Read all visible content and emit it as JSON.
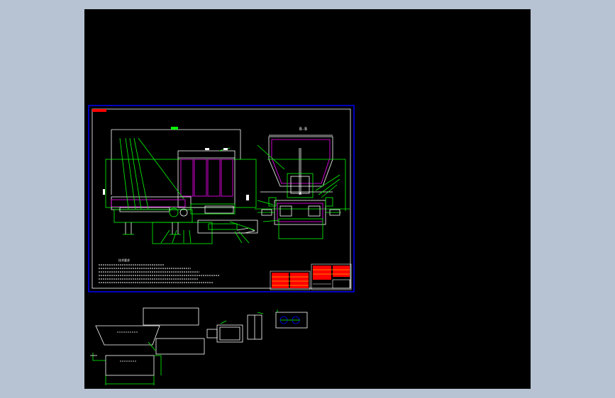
{
  "colors": {
    "background": "#b7c3d3",
    "canvas": "#000000",
    "frame": "#0000ff",
    "outline": "#ffffff",
    "part": "#00ff00",
    "highlight": "#ff00ff",
    "title_block": "#ff0000",
    "accent": "#ffff00"
  },
  "drawing": {
    "view_label": "B-B",
    "scale_marker": "A",
    "notes_heading": "技术要求"
  }
}
